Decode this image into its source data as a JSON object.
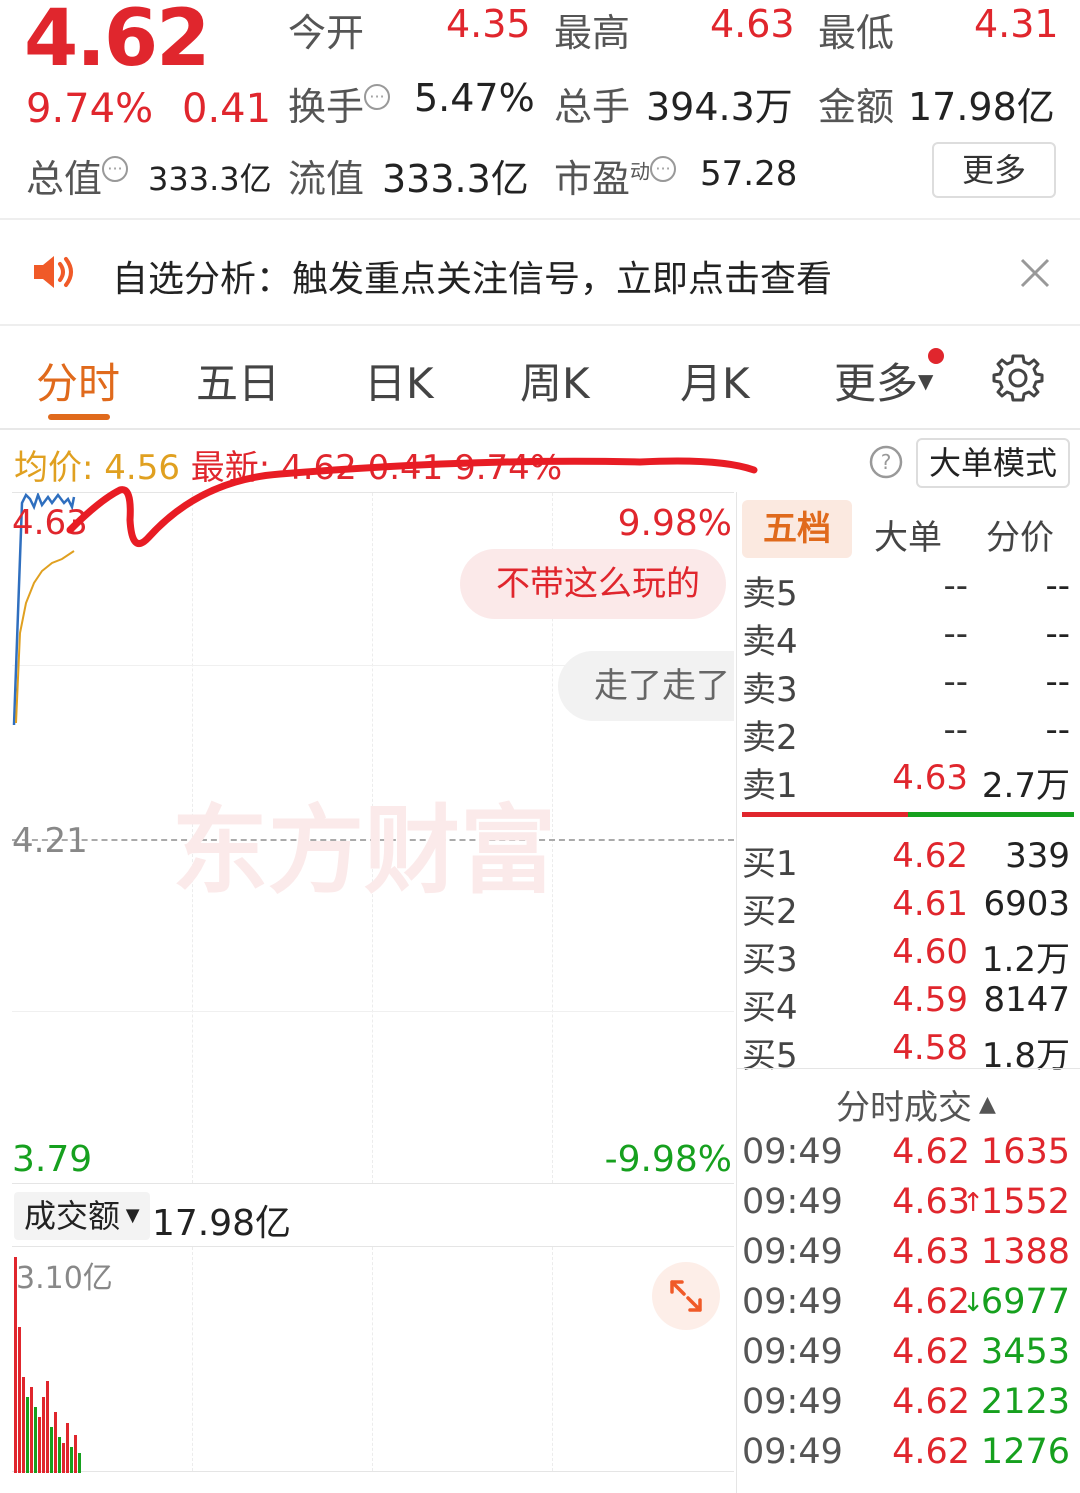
{
  "quote": {
    "price": "4.62",
    "change_pct": "9.74%",
    "change_amt": "0.41",
    "open_label": "今开",
    "open": "4.35",
    "high_label": "最高",
    "high": "4.63",
    "low_label": "最低",
    "low": "4.31",
    "turnover_label": "换手",
    "turnover": "5.47%",
    "volume_label": "总手",
    "volume": "394.3万",
    "amount_label": "金额",
    "amount": "17.98亿",
    "mktcap_label": "总值",
    "mktcap": "333.3亿",
    "float_label": "流值",
    "float": "333.3亿",
    "pe_label": "市盈",
    "pe_sup": "动",
    "pe": "57.28",
    "more": "更多"
  },
  "notice": {
    "text": "自选分析：触发重点关注信号，立即点击查看"
  },
  "tabs": [
    "分时",
    "五日",
    "日K",
    "周K",
    "月K",
    "更多"
  ],
  "summary": {
    "avg_label": "均价:",
    "avg": "4.56",
    "latest_label": "最新:",
    "latest": "4.62",
    "chg": "0.41",
    "pct": "9.74%",
    "mode_button": "大单模式"
  },
  "chart": {
    "y_top": "4.63",
    "y_mid": "4.21",
    "y_bottom": "3.79",
    "pct_top": "9.98%",
    "pct_bottom": "-9.98%",
    "bubble1": "不带这么玩的",
    "bubble2": "走了走了",
    "watermark": "东方财富",
    "vol_selector": "成交额",
    "vol_total": "17.98亿",
    "vol_axis_max": "3.10亿"
  },
  "orderbook": {
    "tabs": [
      "五档",
      "大单",
      "分价"
    ],
    "asks": [
      {
        "label": "卖5",
        "price": "--",
        "vol": "--"
      },
      {
        "label": "卖4",
        "price": "--",
        "vol": "--"
      },
      {
        "label": "卖3",
        "price": "--",
        "vol": "--"
      },
      {
        "label": "卖2",
        "price": "--",
        "vol": "--"
      },
      {
        "label": "卖1",
        "price": "4.63",
        "vol": "2.7万"
      }
    ],
    "bids": [
      {
        "label": "买1",
        "price": "4.62",
        "vol": "339"
      },
      {
        "label": "买2",
        "price": "4.61",
        "vol": "6903"
      },
      {
        "label": "买3",
        "price": "4.60",
        "vol": "1.2万"
      },
      {
        "label": "买4",
        "price": "4.59",
        "vol": "8147"
      },
      {
        "label": "买5",
        "price": "4.58",
        "vol": "1.8万"
      }
    ]
  },
  "trades": {
    "title": "分时成交",
    "rows": [
      {
        "time": "09:49",
        "price": "4.62",
        "arrow": "",
        "vol": "1635",
        "color": "red"
      },
      {
        "time": "09:49",
        "price": "4.63",
        "arrow": "↑",
        "vol": "1552",
        "color": "red"
      },
      {
        "time": "09:49",
        "price": "4.63",
        "arrow": "",
        "vol": "1388",
        "color": "red"
      },
      {
        "time": "09:49",
        "price": "4.62",
        "arrow": "↓",
        "vol": "6977",
        "color": "green"
      },
      {
        "time": "09:49",
        "price": "4.62",
        "arrow": "",
        "vol": "3453",
        "color": "green"
      },
      {
        "time": "09:49",
        "price": "4.62",
        "arrow": "",
        "vol": "2123",
        "color": "green"
      },
      {
        "time": "09:49",
        "price": "4.62",
        "arrow": "",
        "vol": "1276",
        "color": "green"
      }
    ]
  },
  "colors": {
    "up": "#e0262d",
    "down": "#16a01e",
    "accent": "#e06a1c",
    "price_line": "#2f6fbf",
    "avg_line": "#e0a020"
  }
}
